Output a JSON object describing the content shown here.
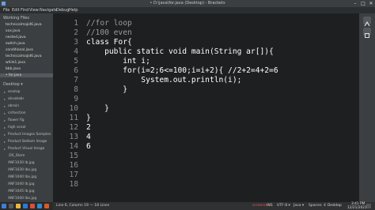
{
  "title": {
    "text": "• D:\\java\\for.java (Desktop) - Brackets",
    "minimize": "–",
    "maximize": "□",
    "close": "✕"
  },
  "menu": [
    "File",
    "Edit",
    "Find",
    "View",
    "Navigate",
    "Debug",
    "Help"
  ],
  "sidebar": {
    "working_files_header": "Working Files",
    "working_files": [
      "technicalmajid6.java",
      "xxx.java",
      "nested.java",
      "switch.java",
      "conditional.java",
      "technicalmajid6.java",
      "while1.java",
      "bbb.java",
      "• for.java"
    ],
    "project_header": "Desktop ▾",
    "project_items": [
      "anutop",
      "akvakabr",
      "obrain",
      "cnfsection",
      "flower fig",
      "high xcool",
      "Product Images Samples",
      "Product Bottom Image",
      "Product Visual Image",
      ".DS_Store",
      "ANF1030 lb.jpg",
      "ANF1030 lbx.jpg",
      "ANF1040 lbx.jpg",
      "ANF1040 lb.jpg",
      "ANF1045 lb.jpg",
      "ANF1040 lbx.jpg"
    ]
  },
  "editor": {
    "line_numbers": [
      "1",
      "2",
      "3",
      "4",
      "5",
      "6",
      "7",
      "8",
      "9",
      "10",
      "11",
      "12",
      "13",
      "14",
      "15",
      "16",
      "17",
      "18"
    ],
    "lines": [
      "//for loop",
      "//100 even",
      "class For{",
      "    public static void main(String ar[]){",
      "        int i;",
      "        for(i=2;6<=100;i=i+2){ //2+2=4+2=6",
      "            System.out.println(i);",
      "        }",
      "",
      "    }",
      "}",
      "2",
      "4",
      "6",
      "",
      "",
      "",
      ""
    ]
  },
  "status": {
    "position": "Line 6, Column 19 — 18 Lines",
    "ins": "INS",
    "encoding": "UTF-8 ▾",
    "language": "Java ▾",
    "spaces": "Spaces: 4"
  },
  "taskbar": {
    "desktop_label": "Desktop",
    "time": "3:41 PM",
    "date": "12/21/2021",
    "watermark": "screenrec"
  }
}
